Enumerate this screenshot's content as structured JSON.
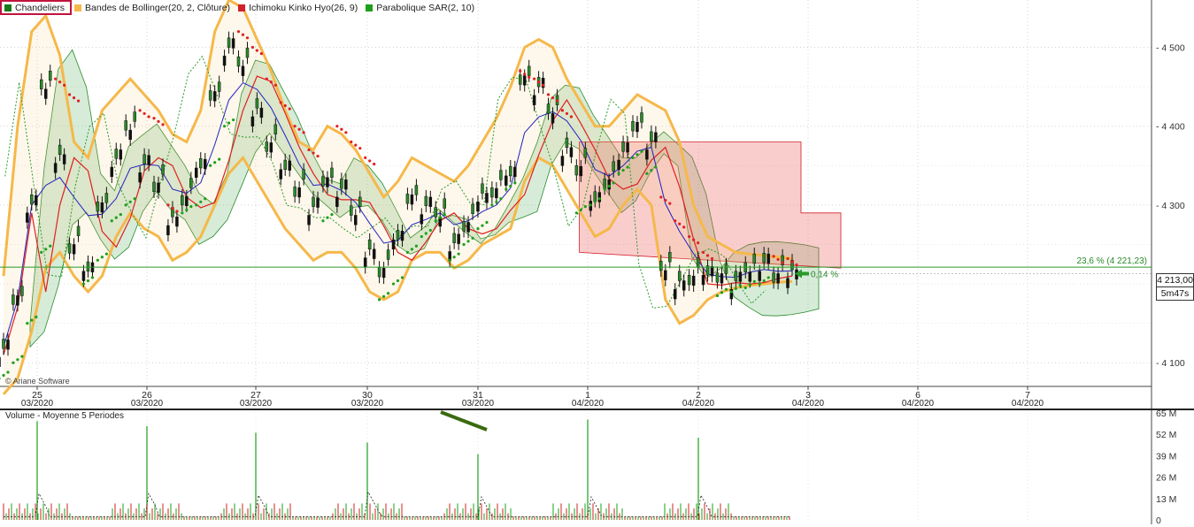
{
  "legend": [
    {
      "label": "Chandeliers",
      "color": "#1a7a1a",
      "active": true
    },
    {
      "label": "Bandes de Bollinger(20, 2, Clôture)",
      "color": "#f5b84a",
      "active": true
    },
    {
      "label": "Ichimoku Kinko Hyo(26, 9)",
      "color": "#d0202a",
      "active": false
    },
    {
      "label": "Parabolique SAR(2, 10)",
      "color": "#1aa01a",
      "active": false
    }
  ],
  "watermark": "© Ariane Software",
  "price_badge": "4 213,00",
  "timer_badge": "5m47s",
  "volume_title": "Volume  - Moyenne 5 Periodes",
  "chart_data": [
    {
      "type": "line",
      "title": "",
      "ylim": [
        4070,
        4560
      ],
      "y_ticks": [
        "4 500",
        "4 400",
        "4 300",
        "4 100"
      ],
      "y_tick_values": [
        4500,
        4400,
        4300,
        4100
      ],
      "x_day_labels": [
        "25",
        "26",
        "27",
        "30",
        "31",
        "1",
        "2",
        "3",
        "6",
        "7"
      ],
      "x_month_labels": [
        "03/2020",
        "03/2020",
        "03/2020",
        "03/2020",
        "03/2020",
        "04/2020",
        "04/2020",
        "04/2020",
        "04/2020",
        "04/2020"
      ],
      "grid": true,
      "fibonacci": {
        "label": "23,6 % (4 221,23)",
        "value": 4221.23
      },
      "variation_label": "0,14 %",
      "last_price": 4213.0,
      "series": [
        {
          "name": "Chandeliers",
          "values": [
            4120,
            4180,
            4300,
            4450,
            4360,
            4250,
            4220,
            4300,
            4360,
            4400,
            4350,
            4330,
            4280,
            4310,
            4350,
            4440,
            4500,
            4480,
            4420,
            4380,
            4350,
            4320,
            4300,
            4330,
            4320,
            4290,
            4240,
            4220,
            4260,
            4310,
            4300,
            4290,
            4250,
            4280,
            4310,
            4320,
            4340,
            4460,
            4450,
            4420,
            4370,
            4350,
            4310,
            4330,
            4370,
            4400,
            4380,
            4220,
            4200,
            4210,
            4215,
            4210,
            4205,
            4220,
            4225,
            4215,
            4213
          ]
        },
        {
          "name": "Bandes de Bollinger (haute)",
          "values": [
            4210,
            4400,
            4520,
            4540,
            4490,
            4380,
            4360,
            4420,
            4440,
            4460,
            4440,
            4420,
            4390,
            4380,
            4420,
            4520,
            4560,
            4550,
            4510,
            4470,
            4420,
            4380,
            4370,
            4400,
            4390,
            4370,
            4340,
            4310,
            4330,
            4360,
            4350,
            4340,
            4330,
            4350,
            4380,
            4410,
            4450,
            4500,
            4510,
            4500,
            4460,
            4430,
            4400,
            4400,
            4420,
            4440,
            4430,
            4420,
            4380,
            4300,
            4260,
            4250,
            4240,
            4238,
            4236,
            4234,
            4232
          ]
        },
        {
          "name": "Bandes de Bollinger (basse)",
          "values": [
            4060,
            4080,
            4140,
            4220,
            4240,
            4210,
            4190,
            4210,
            4260,
            4290,
            4270,
            4260,
            4230,
            4240,
            4260,
            4300,
            4340,
            4360,
            4330,
            4300,
            4270,
            4250,
            4230,
            4240,
            4240,
            4220,
            4190,
            4180,
            4190,
            4230,
            4240,
            4240,
            4220,
            4230,
            4250,
            4260,
            4270,
            4330,
            4360,
            4350,
            4320,
            4290,
            4260,
            4270,
            4300,
            4320,
            4300,
            4180,
            4150,
            4160,
            4180,
            4190,
            4195,
            4198,
            4200,
            4202,
            4203
          ]
        },
        {
          "name": "Parabolique SAR",
          "values": [
            4080,
            4100,
            4150,
            4240,
            4460,
            4440,
            4200,
            4230,
            4280,
            4300,
            4420,
            4410,
            4300,
            4290,
            4300,
            4350,
            4400,
            4520,
            4500,
            4460,
            4430,
            4400,
            4370,
            4280,
            4400,
            4380,
            4360,
            4180,
            4200,
            4240,
            4260,
            4280,
            4230,
            4250,
            4270,
            4300,
            4320,
            4470,
            4460,
            4440,
            4420,
            4290,
            4300,
            4320,
            4340,
            4360,
            4340,
            4310,
            4280,
            4260,
            4240,
            4185,
            4190,
            4195,
            4200,
            4235,
            4232
          ]
        }
      ]
    },
    {
      "type": "bar",
      "title": "",
      "ylim": [
        0,
        65
      ],
      "y_ticks": [
        "65 M",
        "52 M",
        "39 M",
        "26 M",
        "13 M",
        "0"
      ],
      "y_tick_values": [
        65,
        52,
        39,
        26,
        13,
        0
      ],
      "series": [
        {
          "name": "Volume",
          "spikes": [
            {
              "day": "25",
              "value": 60
            },
            {
              "day": "26",
              "value": 57
            },
            {
              "day": "27",
              "value": 53
            },
            {
              "day": "30",
              "value": 47
            },
            {
              "day": "31",
              "value": 40
            },
            {
              "day": "1",
              "value": 61
            },
            {
              "day": "2",
              "value": 50
            }
          ]
        }
      ]
    }
  ]
}
